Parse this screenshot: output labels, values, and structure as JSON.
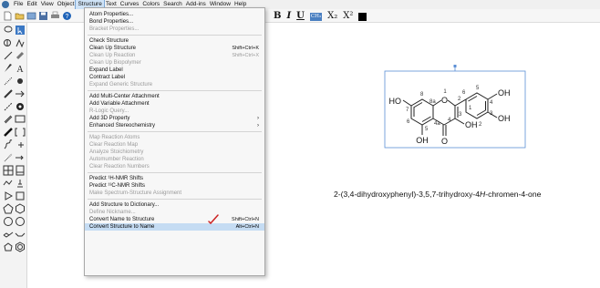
{
  "menubar": {
    "items": [
      {
        "label": "File"
      },
      {
        "label": "Edit"
      },
      {
        "label": "View"
      },
      {
        "label": "Object"
      },
      {
        "label": "Structure"
      },
      {
        "label": "Text"
      },
      {
        "label": "Curves"
      },
      {
        "label": "Colors"
      },
      {
        "label": "Search"
      },
      {
        "label": "Add-ins"
      },
      {
        "label": "Window"
      },
      {
        "label": "Help"
      }
    ]
  },
  "format_bar": {
    "bold": "B",
    "italic": "I",
    "underline": "U",
    "style_box": "CH₃",
    "subscript": "X₂",
    "superscript": "X²"
  },
  "structure_menu": {
    "items": [
      {
        "label": "Atom Properties...",
        "shortcut": "",
        "disabled": false
      },
      {
        "label": "Bond Properties...",
        "shortcut": "",
        "disabled": false
      },
      {
        "label": "Bracket Properties...",
        "shortcut": "",
        "disabled": true
      },
      {
        "label": "Check Structure",
        "shortcut": "",
        "disabled": false
      },
      {
        "label": "Clean Up Structure",
        "shortcut": "Shift+Ctrl+K",
        "disabled": false
      },
      {
        "label": "Clean Up Reaction",
        "shortcut": "Shift+Ctrl+X",
        "disabled": true
      },
      {
        "label": "Clean Up Biopolymer",
        "shortcut": "",
        "disabled": true
      },
      {
        "label": "Expand Label",
        "shortcut": "",
        "disabled": false
      },
      {
        "label": "Contract Label",
        "shortcut": "",
        "disabled": false
      },
      {
        "label": "Expand Generic Structure",
        "shortcut": "",
        "disabled": true
      },
      {
        "label": "Add Multi-Center Attachment",
        "shortcut": "",
        "disabled": false
      },
      {
        "label": "Add Variable Attachment",
        "shortcut": "",
        "disabled": false
      },
      {
        "label": "R-Logic Query...",
        "shortcut": "",
        "disabled": true
      },
      {
        "label": "Add 3D Property",
        "shortcut": "",
        "disabled": false,
        "arrow": "›"
      },
      {
        "label": "Enhanced Stereochemistry",
        "shortcut": "",
        "disabled": false,
        "arrow": "›"
      },
      {
        "label": "Map Reaction Atoms",
        "shortcut": "",
        "disabled": true
      },
      {
        "label": "Clear Reaction Map",
        "shortcut": "",
        "disabled": true
      },
      {
        "label": "Analyze Stoichiometry",
        "shortcut": "",
        "disabled": true
      },
      {
        "label": "Automumber Reaction",
        "shortcut": "",
        "disabled": true
      },
      {
        "label": "Clear Reaction Numbers",
        "shortcut": "",
        "disabled": true
      },
      {
        "label": "Predict ¹H-NMR Shifts",
        "shortcut": "",
        "disabled": false
      },
      {
        "label": "Predict ¹³C-NMR Shifts",
        "shortcut": "",
        "disabled": false
      },
      {
        "label": "Make Spectrum-Structure Assignment",
        "shortcut": "",
        "disabled": true
      },
      {
        "label": "Add Structure to Dictionary...",
        "shortcut": "",
        "disabled": false
      },
      {
        "label": "Define Nickname...",
        "shortcut": "",
        "disabled": true
      },
      {
        "label": "Convert Name to Structure",
        "shortcut": "Shift+Ctrl+N",
        "disabled": false
      },
      {
        "label": "Convert Structure to Name",
        "shortcut": "Alt+Ctrl+N",
        "disabled": false,
        "highlight": true
      }
    ]
  },
  "molecule": {
    "labels": {
      "o1": "O",
      "ho7": "HO",
      "oh4p": "OH",
      "oh3p": "OH",
      "oh3": "OH",
      "oh5": "OH",
      "o4": "O",
      "n1": "1",
      "n2": "2",
      "n3": "3",
      "n4": "4",
      "n4a": "4a",
      "n5": "5",
      "n6": "6",
      "n7": "7",
      "n8": "8",
      "n8a": "8a",
      "n1p": "1",
      "n2p": "2",
      "n3p": "3",
      "n4p": "4",
      "n5p": "5",
      "n6p": "6"
    }
  },
  "chemical_name": {
    "prefix": "2-(3,4-dihydroxyphenyl)-3,5,7-trihydroxy-4",
    "italic": "H",
    "suffix": "-chromen-4-one"
  },
  "colors": {
    "selection": "#5b8fd6",
    "highlight": "#c5dcf3",
    "cursor_mark": "#cc2222"
  }
}
